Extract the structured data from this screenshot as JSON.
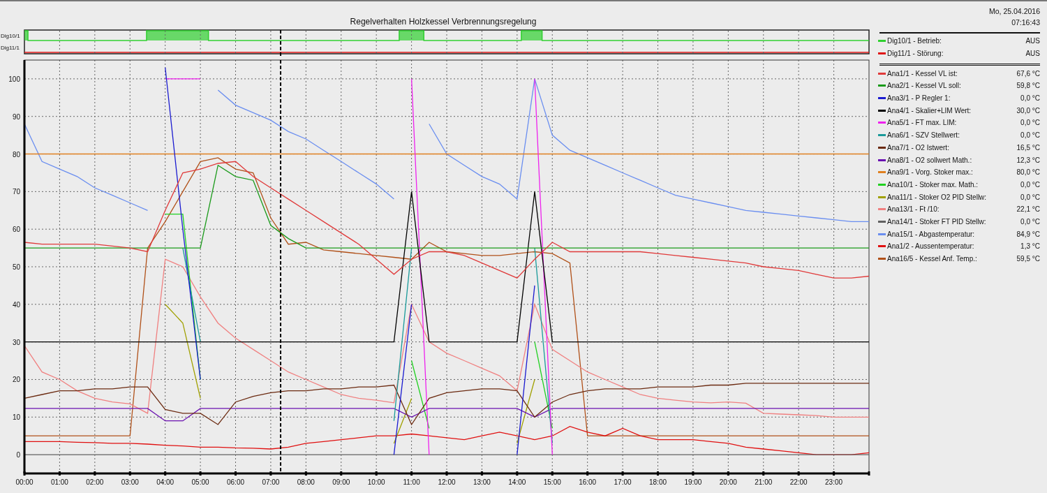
{
  "title": "Regelverhalten Holzkessel Verbrennungsregelung",
  "date": "Mo, 25.04.2016",
  "time": "07:16:43",
  "digital_chart": {
    "track_labels": [
      "Dig10/1",
      "Dig11/1"
    ],
    "legend": [
      {
        "label": "Dig10/1 - Betrieb:",
        "value": "AUS",
        "color": "#30d030"
      },
      {
        "label": "Dig11/1 - Störung:",
        "value": "AUS",
        "color": "#e01818"
      }
    ]
  },
  "analog_chart": {
    "legend_values": [
      "67,6 °C",
      "59,8 °C",
      "0,0 °C",
      "30,0 °C",
      "0,0 °C",
      "0,0 °C",
      "16,5 °C",
      "12,3 °C",
      "80,0 °C",
      "0,0 °C",
      "0,0 °C",
      "22,1 °C",
      "0,0 °C",
      "84,9 °C",
      "1,3 °C",
      "59,5 °C"
    ],
    "chart_data": {
      "type": "line",
      "grid": true,
      "xlim": [
        0,
        24
      ],
      "ylim": [
        -5,
        105
      ],
      "x": [
        0,
        0.5,
        1,
        1.5,
        2,
        2.5,
        3,
        3.5,
        4,
        4.5,
        5,
        5.5,
        6,
        6.5,
        7,
        7.5,
        8,
        8.5,
        9,
        9.5,
        10,
        10.5,
        11,
        11.5,
        12,
        12.5,
        13,
        13.5,
        14,
        14.5,
        15,
        15.5,
        16,
        16.5,
        17,
        17.5,
        18,
        18.5,
        19,
        19.5,
        20,
        20.5,
        21,
        21.5,
        22,
        22.5,
        23,
        23.5,
        24
      ],
      "xticks": [
        {
          "value": 0,
          "label": "00:00"
        },
        {
          "value": 1,
          "label": "01:00"
        },
        {
          "value": 2,
          "label": "02:00"
        },
        {
          "value": 3,
          "label": "03:00"
        },
        {
          "value": 4,
          "label": "04:00"
        },
        {
          "value": 5,
          "label": "05:00"
        },
        {
          "value": 6,
          "label": "06:00"
        },
        {
          "value": 7,
          "label": "07:00"
        },
        {
          "value": 8,
          "label": "08:00"
        },
        {
          "value": 9,
          "label": "09:00"
        },
        {
          "value": 10,
          "label": "10:00"
        },
        {
          "value": 11,
          "label": "11:00"
        },
        {
          "value": 12,
          "label": "12:00"
        },
        {
          "value": 13,
          "label": "13:00"
        },
        {
          "value": 14,
          "label": "14:00"
        },
        {
          "value": 15,
          "label": "15:00"
        },
        {
          "value": 16,
          "label": "16:00"
        },
        {
          "value": 17,
          "label": "17:00"
        },
        {
          "value": 18,
          "label": "18:00"
        },
        {
          "value": 19,
          "label": "19:00"
        },
        {
          "value": 20,
          "label": "20:00"
        },
        {
          "value": 21,
          "label": "21:00"
        },
        {
          "value": 22,
          "label": "22:00"
        },
        {
          "value": 23,
          "label": "23:00"
        }
      ],
      "yticks": [
        0,
        10,
        20,
        30,
        40,
        50,
        60,
        70,
        80,
        90,
        100
      ],
      "ref_lines": [
        {
          "axis": "x",
          "value": 7.28
        }
      ],
      "series": [
        {
          "name": "Ana1/1 - Kessel VL ist:",
          "color": "#e03a3a",
          "values": [
            56.5,
            56,
            56,
            56,
            56,
            55.5,
            55,
            54,
            65,
            75,
            76,
            77.5,
            78,
            74,
            71,
            68,
            65,
            62,
            59,
            56,
            52,
            48,
            52,
            54,
            54,
            53,
            51,
            49,
            47,
            52,
            56.5,
            54,
            54,
            54,
            54,
            54,
            53.5,
            53,
            52.5,
            52,
            51.5,
            51,
            50,
            49.5,
            49,
            48,
            47,
            47,
            47.5
          ]
        },
        {
          "name": "Ana2/1 - Kessel VL soll:",
          "color": "#1a9a1a",
          "values": [
            55,
            55,
            55,
            55,
            55,
            55,
            55,
            55,
            55,
            55,
            55,
            77,
            74,
            73,
            61,
            57.5,
            55,
            55,
            55,
            55,
            55,
            55,
            55,
            55,
            55,
            55,
            55,
            55,
            55,
            55,
            55,
            55,
            55,
            55,
            55,
            55,
            55,
            55,
            55,
            55,
            55,
            55,
            55,
            55,
            55,
            55,
            55,
            55,
            55
          ]
        },
        {
          "name": "Ana3/1 - P Regler 1:",
          "color": "#1a1ad0",
          "values": [
            null,
            null,
            null,
            null,
            null,
            null,
            null,
            null,
            103,
            60,
            20,
            null,
            null,
            null,
            null,
            null,
            null,
            null,
            null,
            null,
            null,
            0,
            40,
            null,
            null,
            null,
            null,
            null,
            0,
            45,
            null,
            null,
            null,
            null,
            null,
            null,
            null,
            null,
            null,
            null,
            null,
            null,
            null,
            null,
            null,
            null,
            null,
            null,
            null
          ]
        },
        {
          "name": "Ana4/1 - Skalier+LIM Wert:",
          "color": "#000000",
          "values": [
            30,
            30,
            30,
            30,
            30,
            30,
            30,
            30,
            30,
            30,
            30,
            30,
            30,
            30,
            30,
            30,
            30,
            30,
            30,
            30,
            30,
            30,
            70,
            30,
            30,
            30,
            30,
            30,
            30,
            70,
            30,
            30,
            30,
            30,
            30,
            30,
            30,
            30,
            30,
            30,
            30,
            30,
            30,
            30,
            30,
            30,
            30,
            30,
            30
          ]
        },
        {
          "name": "Ana5/1 - FT max. LIM:",
          "color": "#ee22ee",
          "values": [
            null,
            null,
            null,
            null,
            null,
            null,
            null,
            null,
            100,
            100,
            100,
            null,
            null,
            null,
            null,
            null,
            null,
            null,
            null,
            null,
            null,
            null,
            100,
            0,
            null,
            null,
            null,
            null,
            null,
            100,
            0,
            null,
            null,
            null,
            null,
            null,
            null,
            null,
            null,
            null,
            null,
            null,
            null,
            null,
            null,
            null,
            null,
            null,
            null
          ]
        },
        {
          "name": "Ana6/1 - SZV Stellwert:",
          "color": "#1a9a9a",
          "values": [
            null,
            null,
            null,
            null,
            null,
            null,
            null,
            null,
            null,
            55,
            30,
            null,
            null,
            null,
            null,
            null,
            null,
            null,
            null,
            null,
            null,
            9,
            55,
            null,
            null,
            null,
            null,
            null,
            null,
            55,
            3,
            null,
            null,
            null,
            null,
            null,
            null,
            null,
            null,
            null,
            null,
            null,
            null,
            null,
            null,
            null,
            null,
            null,
            null
          ]
        },
        {
          "name": "Ana7/1 - O2 Istwert:",
          "color": "#6b2a10",
          "values": [
            15,
            16,
            17,
            17,
            17.5,
            17.5,
            18,
            18,
            12,
            11,
            11,
            8,
            14,
            15.5,
            16.5,
            17,
            17,
            17.5,
            17.5,
            18,
            18,
            18.5,
            8,
            15,
            16.5,
            17,
            17.5,
            17.5,
            17,
            10,
            14,
            16,
            17,
            17.5,
            17.5,
            17.5,
            18,
            18,
            18,
            18.5,
            18.5,
            19,
            19,
            19,
            19,
            19,
            19,
            19,
            19
          ]
        },
        {
          "name": "Ana8/1 - O2 sollwert Math.:",
          "color": "#6a10b0",
          "values": [
            12.3,
            12.3,
            12.3,
            12.3,
            12.3,
            12.3,
            12.3,
            12.3,
            9,
            9,
            12.3,
            12.3,
            12.3,
            12.3,
            12.3,
            12.3,
            12.3,
            12.3,
            12.3,
            12.3,
            12.3,
            12.3,
            10,
            12.3,
            12.3,
            12.3,
            12.3,
            12.3,
            12.3,
            10,
            12.3,
            12.3,
            12.3,
            12.3,
            12.3,
            12.3,
            12.3,
            12.3,
            12.3,
            12.3,
            12.3,
            12.3,
            12.3,
            12.3,
            12.3,
            12.3,
            12.3,
            12.3,
            12.3
          ]
        },
        {
          "name": "Ana9/1 - Vorg. Stoker max.:",
          "color": "#e08020",
          "values": [
            80,
            80,
            80,
            80,
            80,
            80,
            80,
            80,
            80,
            80,
            80,
            80,
            80,
            80,
            80,
            80,
            80,
            80,
            80,
            80,
            80,
            80,
            80,
            80,
            80,
            80,
            80,
            80,
            80,
            80,
            80,
            80,
            80,
            80,
            80,
            80,
            80,
            80,
            80,
            80,
            80,
            80,
            80,
            80,
            80,
            80,
            80,
            80,
            80
          ]
        },
        {
          "name": "Ana10/1 - Stoker max. Math.:",
          "color": "#20d020",
          "values": [
            null,
            null,
            null,
            null,
            null,
            null,
            null,
            null,
            64,
            64,
            20,
            null,
            null,
            null,
            null,
            null,
            null,
            null,
            null,
            null,
            null,
            null,
            25,
            7,
            null,
            null,
            null,
            null,
            null,
            30,
            7,
            null,
            null,
            null,
            null,
            null,
            null,
            null,
            null,
            null,
            null,
            null,
            null,
            null,
            null,
            null,
            null,
            null,
            null
          ]
        },
        {
          "name": "Ana11/1 - Stoker O2 PID Stellw:",
          "color": "#a0a000",
          "values": [
            null,
            null,
            null,
            null,
            null,
            null,
            null,
            null,
            40,
            35,
            15,
            null,
            null,
            null,
            null,
            null,
            null,
            null,
            null,
            null,
            null,
            3,
            15,
            null,
            null,
            null,
            null,
            null,
            3,
            20,
            null,
            null,
            null,
            null,
            null,
            null,
            null,
            null,
            null,
            null,
            null,
            null,
            null,
            null,
            null,
            null,
            null,
            null,
            null
          ]
        },
        {
          "name": "Ana13/1 - Ft /10:",
          "color": "#f08080",
          "values": [
            29,
            22,
            20,
            17,
            15,
            14,
            13.5,
            11,
            52,
            50,
            42,
            35,
            31,
            28,
            25,
            22,
            20,
            18,
            16,
            15,
            14.5,
            13.8,
            40,
            30,
            27,
            25,
            23,
            21,
            17,
            40,
            28,
            25,
            22,
            20,
            18,
            16,
            15,
            14.5,
            14,
            13.8,
            14,
            13.7,
            11,
            10.8,
            10.6,
            10.4,
            10,
            10,
            10
          ]
        },
        {
          "name": "Ana14/1 - Stoker FT PID Stellw:",
          "color": "#606060",
          "values": [
            0,
            0,
            0,
            0,
            0,
            0,
            0,
            0,
            0,
            0,
            0,
            0,
            0,
            0,
            0,
            0,
            0,
            0,
            0,
            0,
            0,
            0,
            0,
            0,
            0,
            0,
            0,
            0,
            0,
            0,
            0,
            0,
            0,
            0,
            0,
            0,
            0,
            0,
            0,
            0,
            0,
            0,
            0,
            0,
            0,
            0,
            0,
            0,
            0
          ]
        },
        {
          "name": "Ana15/1 - Abgastemperatur:",
          "color": "#6a8ef0",
          "values": [
            88,
            78,
            76,
            74,
            71,
            69,
            67,
            65,
            null,
            null,
            null,
            97,
            93,
            91,
            89,
            86,
            84,
            81,
            78,
            75,
            72,
            68,
            null,
            88,
            80,
            77,
            74,
            72,
            68,
            100,
            85,
            81,
            79,
            77,
            75,
            73,
            71,
            69,
            68,
            67,
            66,
            65,
            64.5,
            64,
            63.5,
            63,
            62.5,
            62,
            62
          ]
        },
        {
          "name": "Ana1/2 - Aussentemperatur:",
          "color": "#e01010",
          "values": [
            3.5,
            3.5,
            3.5,
            3.3,
            3.2,
            3,
            3,
            2.8,
            2.5,
            2.3,
            2,
            2,
            1.8,
            1.7,
            1.5,
            2,
            3,
            3.5,
            4,
            4.5,
            5,
            5,
            5.5,
            5,
            4.5,
            4,
            5,
            6,
            5,
            4,
            5,
            7.5,
            6,
            5,
            7,
            5,
            4,
            4,
            4,
            3.5,
            3,
            2,
            1.5,
            1,
            0.5,
            0,
            0,
            0,
            0.5
          ]
        },
        {
          "name": "Ana16/5 - Kessel Anf. Temp.:",
          "color": "#b05018",
          "values": [
            5,
            5,
            5,
            5,
            5,
            5,
            5,
            55,
            62,
            70,
            78,
            79,
            76,
            75,
            63,
            56,
            56.5,
            54.5,
            54,
            53.5,
            53,
            52.5,
            52,
            56.5,
            54,
            53.5,
            53,
            53,
            53.5,
            54,
            53.5,
            51,
            5,
            5,
            5,
            5,
            5,
            5,
            5,
            5,
            5,
            5,
            5,
            5,
            5,
            5,
            5,
            5,
            5
          ]
        }
      ]
    }
  }
}
